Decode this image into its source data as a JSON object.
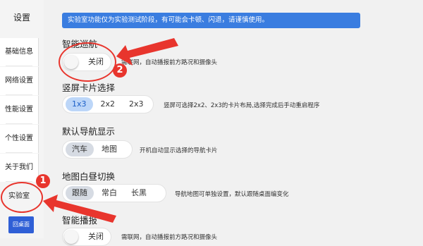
{
  "sidebar": {
    "title": "设置",
    "items": [
      {
        "label": "基础信息"
      },
      {
        "label": "网络设置"
      },
      {
        "label": "性能设置"
      },
      {
        "label": "个性设置"
      },
      {
        "label": "关于我们"
      },
      {
        "label": "实验室"
      }
    ],
    "back_label": "回桌面"
  },
  "notice": "实验室功能仅为实验测试阶段，有可能会卡顿、闪退，请谨慎使用。",
  "sections": {
    "nav": {
      "title": "智能巡航",
      "toggle_label": "关闭",
      "desc": "需联网，自动播报前方路况和摄像头"
    },
    "card": {
      "title": "竖屏卡片选择",
      "options": [
        "1x3",
        "2x2",
        "2x3"
      ],
      "selected": "1x3",
      "desc": "竖屏可选择2x2、2x3的卡片布局,选择完成后手动重启程序"
    },
    "default_nav": {
      "title": "默认导航显示",
      "options": [
        "汽车",
        "地图"
      ],
      "selected": "汽车",
      "desc": "开机自动显示选择的导航卡片"
    },
    "daynight": {
      "title": "地图白昼切换",
      "options": [
        "跟随",
        "常白",
        "长黑"
      ],
      "selected": "跟随",
      "desc": "导航地图可单独设置，默认跟随桌面编变化"
    },
    "broadcast": {
      "title": "智能播报",
      "toggle_label": "关闭",
      "desc": "需联网，自动播报前方路况和摄像头"
    }
  },
  "annotations": {
    "badge1": "1",
    "badge2": "2"
  },
  "colors": {
    "accent": "#3a7de0",
    "back_button": "#2f5fd6",
    "annotation": "#e8352d"
  }
}
